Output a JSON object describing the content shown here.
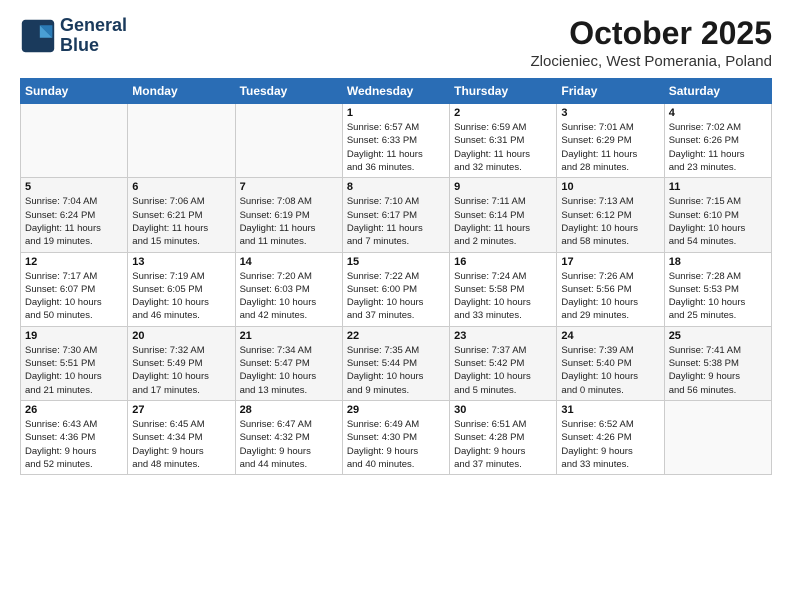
{
  "header": {
    "logo_line1": "General",
    "logo_line2": "Blue",
    "title": "October 2025",
    "subtitle": "Zlocieniec, West Pomerania, Poland"
  },
  "weekdays": [
    "Sunday",
    "Monday",
    "Tuesday",
    "Wednesday",
    "Thursday",
    "Friday",
    "Saturday"
  ],
  "weeks": [
    [
      {
        "day": "",
        "info": ""
      },
      {
        "day": "",
        "info": ""
      },
      {
        "day": "",
        "info": ""
      },
      {
        "day": "1",
        "info": "Sunrise: 6:57 AM\nSunset: 6:33 PM\nDaylight: 11 hours\nand 36 minutes."
      },
      {
        "day": "2",
        "info": "Sunrise: 6:59 AM\nSunset: 6:31 PM\nDaylight: 11 hours\nand 32 minutes."
      },
      {
        "day": "3",
        "info": "Sunrise: 7:01 AM\nSunset: 6:29 PM\nDaylight: 11 hours\nand 28 minutes."
      },
      {
        "day": "4",
        "info": "Sunrise: 7:02 AM\nSunset: 6:26 PM\nDaylight: 11 hours\nand 23 minutes."
      }
    ],
    [
      {
        "day": "5",
        "info": "Sunrise: 7:04 AM\nSunset: 6:24 PM\nDaylight: 11 hours\nand 19 minutes."
      },
      {
        "day": "6",
        "info": "Sunrise: 7:06 AM\nSunset: 6:21 PM\nDaylight: 11 hours\nand 15 minutes."
      },
      {
        "day": "7",
        "info": "Sunrise: 7:08 AM\nSunset: 6:19 PM\nDaylight: 11 hours\nand 11 minutes."
      },
      {
        "day": "8",
        "info": "Sunrise: 7:10 AM\nSunset: 6:17 PM\nDaylight: 11 hours\nand 7 minutes."
      },
      {
        "day": "9",
        "info": "Sunrise: 7:11 AM\nSunset: 6:14 PM\nDaylight: 11 hours\nand 2 minutes."
      },
      {
        "day": "10",
        "info": "Sunrise: 7:13 AM\nSunset: 6:12 PM\nDaylight: 10 hours\nand 58 minutes."
      },
      {
        "day": "11",
        "info": "Sunrise: 7:15 AM\nSunset: 6:10 PM\nDaylight: 10 hours\nand 54 minutes."
      }
    ],
    [
      {
        "day": "12",
        "info": "Sunrise: 7:17 AM\nSunset: 6:07 PM\nDaylight: 10 hours\nand 50 minutes."
      },
      {
        "day": "13",
        "info": "Sunrise: 7:19 AM\nSunset: 6:05 PM\nDaylight: 10 hours\nand 46 minutes."
      },
      {
        "day": "14",
        "info": "Sunrise: 7:20 AM\nSunset: 6:03 PM\nDaylight: 10 hours\nand 42 minutes."
      },
      {
        "day": "15",
        "info": "Sunrise: 7:22 AM\nSunset: 6:00 PM\nDaylight: 10 hours\nand 37 minutes."
      },
      {
        "day": "16",
        "info": "Sunrise: 7:24 AM\nSunset: 5:58 PM\nDaylight: 10 hours\nand 33 minutes."
      },
      {
        "day": "17",
        "info": "Sunrise: 7:26 AM\nSunset: 5:56 PM\nDaylight: 10 hours\nand 29 minutes."
      },
      {
        "day": "18",
        "info": "Sunrise: 7:28 AM\nSunset: 5:53 PM\nDaylight: 10 hours\nand 25 minutes."
      }
    ],
    [
      {
        "day": "19",
        "info": "Sunrise: 7:30 AM\nSunset: 5:51 PM\nDaylight: 10 hours\nand 21 minutes."
      },
      {
        "day": "20",
        "info": "Sunrise: 7:32 AM\nSunset: 5:49 PM\nDaylight: 10 hours\nand 17 minutes."
      },
      {
        "day": "21",
        "info": "Sunrise: 7:34 AM\nSunset: 5:47 PM\nDaylight: 10 hours\nand 13 minutes."
      },
      {
        "day": "22",
        "info": "Sunrise: 7:35 AM\nSunset: 5:44 PM\nDaylight: 10 hours\nand 9 minutes."
      },
      {
        "day": "23",
        "info": "Sunrise: 7:37 AM\nSunset: 5:42 PM\nDaylight: 10 hours\nand 5 minutes."
      },
      {
        "day": "24",
        "info": "Sunrise: 7:39 AM\nSunset: 5:40 PM\nDaylight: 10 hours\nand 0 minutes."
      },
      {
        "day": "25",
        "info": "Sunrise: 7:41 AM\nSunset: 5:38 PM\nDaylight: 9 hours\nand 56 minutes."
      }
    ],
    [
      {
        "day": "26",
        "info": "Sunrise: 6:43 AM\nSunset: 4:36 PM\nDaylight: 9 hours\nand 52 minutes."
      },
      {
        "day": "27",
        "info": "Sunrise: 6:45 AM\nSunset: 4:34 PM\nDaylight: 9 hours\nand 48 minutes."
      },
      {
        "day": "28",
        "info": "Sunrise: 6:47 AM\nSunset: 4:32 PM\nDaylight: 9 hours\nand 44 minutes."
      },
      {
        "day": "29",
        "info": "Sunrise: 6:49 AM\nSunset: 4:30 PM\nDaylight: 9 hours\nand 40 minutes."
      },
      {
        "day": "30",
        "info": "Sunrise: 6:51 AM\nSunset: 4:28 PM\nDaylight: 9 hours\nand 37 minutes."
      },
      {
        "day": "31",
        "info": "Sunrise: 6:52 AM\nSunset: 4:26 PM\nDaylight: 9 hours\nand 33 minutes."
      },
      {
        "day": "",
        "info": ""
      }
    ]
  ]
}
